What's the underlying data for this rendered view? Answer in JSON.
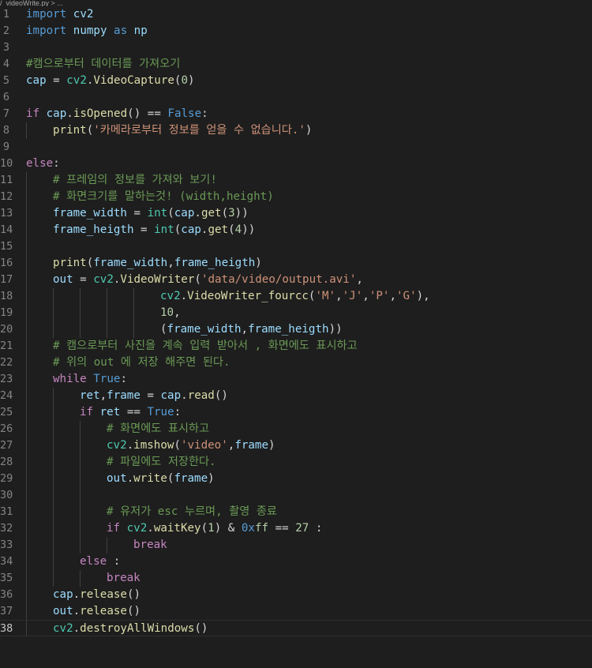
{
  "breadcrumb": "/_videoWrite.py > ...",
  "active_line": 38,
  "colors": {
    "background": "#1e1e1e",
    "keyword": "#569cd6",
    "control": "#c586c0",
    "variable": "#9cdcfe",
    "module": "#4ec9b0",
    "function": "#dcdcaa",
    "string": "#ce9178",
    "number": "#b5cea8",
    "comment": "#6a9955",
    "plain": "#d4d4d4",
    "line_number": "#858585"
  },
  "lines": [
    {
      "n": "1",
      "indent": 0,
      "tokens": [
        [
          "import",
          "kw"
        ],
        [
          " cv2",
          "var"
        ]
      ]
    },
    {
      "n": "2",
      "indent": 0,
      "tokens": [
        [
          "import",
          "kw"
        ],
        [
          " numpy ",
          "var"
        ],
        [
          "as",
          "kw"
        ],
        [
          " np",
          "var"
        ]
      ]
    },
    {
      "n": "3",
      "indent": 0,
      "tokens": []
    },
    {
      "n": "4",
      "indent": 0,
      "tokens": [
        [
          "#캠으로부터 데이터를 가져오기",
          "com"
        ]
      ]
    },
    {
      "n": "5",
      "indent": 0,
      "tokens": [
        [
          "cap",
          "var"
        ],
        [
          " = ",
          "plain"
        ],
        [
          "cv2",
          "mod"
        ],
        [
          ".",
          "plain"
        ],
        [
          "VideoCapture",
          "fn"
        ],
        [
          "(",
          "plain"
        ],
        [
          "0",
          "num"
        ],
        [
          ")",
          "plain"
        ]
      ]
    },
    {
      "n": "6",
      "indent": 0,
      "tokens": []
    },
    {
      "n": "7",
      "indent": 0,
      "tokens": [
        [
          "if",
          "ctrl"
        ],
        [
          " cap",
          "var"
        ],
        [
          ".",
          "plain"
        ],
        [
          "isOpened",
          "fn"
        ],
        [
          "() == ",
          "plain"
        ],
        [
          "False",
          "kw"
        ],
        [
          ":",
          "plain"
        ]
      ]
    },
    {
      "n": "8",
      "indent": 1,
      "tokens": [
        [
          "print",
          "fn"
        ],
        [
          "(",
          "plain"
        ],
        [
          "'카메라로부터 정보를 얻을 수 없습니다.'",
          "str"
        ],
        [
          ")",
          "plain"
        ]
      ]
    },
    {
      "n": "9",
      "indent": 0,
      "tokens": []
    },
    {
      "n": "10",
      "indent": 0,
      "tokens": [
        [
          "else",
          "ctrl"
        ],
        [
          ":",
          "plain"
        ]
      ]
    },
    {
      "n": "11",
      "indent": 1,
      "tokens": [
        [
          "# 프레임의 정보를 가져와 보기!",
          "com"
        ]
      ]
    },
    {
      "n": "12",
      "indent": 1,
      "tokens": [
        [
          "# 화면크기를 말하는것! (width,height)",
          "com"
        ]
      ]
    },
    {
      "n": "13",
      "indent": 1,
      "tokens": [
        [
          "frame_width",
          "var"
        ],
        [
          " = ",
          "plain"
        ],
        [
          "int",
          "mod"
        ],
        [
          "(",
          "plain"
        ],
        [
          "cap",
          "var"
        ],
        [
          ".",
          "plain"
        ],
        [
          "get",
          "fn"
        ],
        [
          "(",
          "plain"
        ],
        [
          "3",
          "num"
        ],
        [
          "))",
          "plain"
        ]
      ]
    },
    {
      "n": "14",
      "indent": 1,
      "tokens": [
        [
          "frame_heigth",
          "var"
        ],
        [
          " = ",
          "plain"
        ],
        [
          "int",
          "mod"
        ],
        [
          "(",
          "plain"
        ],
        [
          "cap",
          "var"
        ],
        [
          ".",
          "plain"
        ],
        [
          "get",
          "fn"
        ],
        [
          "(",
          "plain"
        ],
        [
          "4",
          "num"
        ],
        [
          "))",
          "plain"
        ]
      ]
    },
    {
      "n": "15",
      "indent": 1,
      "tokens": []
    },
    {
      "n": "16",
      "indent": 1,
      "tokens": [
        [
          "print",
          "fn"
        ],
        [
          "(",
          "plain"
        ],
        [
          "frame_width",
          "var"
        ],
        [
          ",",
          "plain"
        ],
        [
          "frame_heigth",
          "var"
        ],
        [
          ")",
          "plain"
        ]
      ]
    },
    {
      "n": "17",
      "indent": 1,
      "tokens": [
        [
          "out",
          "var"
        ],
        [
          " = ",
          "plain"
        ],
        [
          "cv2",
          "mod"
        ],
        [
          ".",
          "plain"
        ],
        [
          "VideoWriter",
          "fn"
        ],
        [
          "(",
          "plain"
        ],
        [
          "'data/video/output.avi'",
          "str"
        ],
        [
          ",",
          "plain"
        ]
      ]
    },
    {
      "n": "18",
      "indent": 5,
      "tokens": [
        [
          "cv2",
          "mod"
        ],
        [
          ".",
          "plain"
        ],
        [
          "VideoWriter_fourcc",
          "fn"
        ],
        [
          "(",
          "plain"
        ],
        [
          "'M'",
          "str"
        ],
        [
          ",",
          "plain"
        ],
        [
          "'J'",
          "str"
        ],
        [
          ",",
          "plain"
        ],
        [
          "'P'",
          "str"
        ],
        [
          ",",
          "plain"
        ],
        [
          "'G'",
          "str"
        ],
        [
          "),",
          "plain"
        ]
      ]
    },
    {
      "n": "19",
      "indent": 5,
      "tokens": [
        [
          "10",
          "num"
        ],
        [
          ",",
          "plain"
        ]
      ]
    },
    {
      "n": "20",
      "indent": 5,
      "tokens": [
        [
          "(",
          "plain"
        ],
        [
          "frame_width",
          "var"
        ],
        [
          ",",
          "plain"
        ],
        [
          "frame_heigth",
          "var"
        ],
        [
          "))",
          "plain"
        ]
      ]
    },
    {
      "n": "21",
      "indent": 1,
      "tokens": [
        [
          "# 캠으로부터 사진을 계속 입력 받아서 , 화면에도 표시하고",
          "com"
        ]
      ]
    },
    {
      "n": "22",
      "indent": 1,
      "tokens": [
        [
          "# 위의 out 에 저장 해주면 된다.",
          "com"
        ]
      ]
    },
    {
      "n": "23",
      "indent": 1,
      "tokens": [
        [
          "while",
          "ctrl"
        ],
        [
          " ",
          "plain"
        ],
        [
          "True",
          "kw"
        ],
        [
          ":",
          "plain"
        ]
      ]
    },
    {
      "n": "24",
      "indent": 2,
      "tokens": [
        [
          "ret",
          "var"
        ],
        [
          ",",
          "plain"
        ],
        [
          "frame",
          "var"
        ],
        [
          " = ",
          "plain"
        ],
        [
          "cap",
          "var"
        ],
        [
          ".",
          "plain"
        ],
        [
          "read",
          "fn"
        ],
        [
          "()",
          "plain"
        ]
      ]
    },
    {
      "n": "25",
      "indent": 2,
      "tokens": [
        [
          "if",
          "ctrl"
        ],
        [
          " ret ",
          "var"
        ],
        [
          "== ",
          "plain"
        ],
        [
          "True",
          "kw"
        ],
        [
          ":",
          "plain"
        ]
      ]
    },
    {
      "n": "26",
      "indent": 3,
      "tokens": [
        [
          "# 화면에도 표시하고",
          "com"
        ]
      ]
    },
    {
      "n": "27",
      "indent": 3,
      "tokens": [
        [
          "cv2",
          "mod"
        ],
        [
          ".",
          "plain"
        ],
        [
          "imshow",
          "fn"
        ],
        [
          "(",
          "plain"
        ],
        [
          "'video'",
          "str"
        ],
        [
          ",",
          "plain"
        ],
        [
          "frame",
          "var"
        ],
        [
          ")",
          "plain"
        ]
      ]
    },
    {
      "n": "28",
      "indent": 3,
      "tokens": [
        [
          "# 파일에도 저장한다.",
          "com"
        ]
      ]
    },
    {
      "n": "29",
      "indent": 3,
      "tokens": [
        [
          "out",
          "var"
        ],
        [
          ".",
          "plain"
        ],
        [
          "write",
          "fn"
        ],
        [
          "(",
          "plain"
        ],
        [
          "frame",
          "var"
        ],
        [
          ")",
          "plain"
        ]
      ]
    },
    {
      "n": "30",
      "indent": 3,
      "tokens": []
    },
    {
      "n": "31",
      "indent": 3,
      "tokens": [
        [
          "# 유저가 esc 누르며, 촬영 종료",
          "com"
        ]
      ]
    },
    {
      "n": "32",
      "indent": 3,
      "tokens": [
        [
          "if",
          "ctrl"
        ],
        [
          " ",
          "plain"
        ],
        [
          "cv2",
          "mod"
        ],
        [
          ".",
          "plain"
        ],
        [
          "waitKey",
          "fn"
        ],
        [
          "(",
          "plain"
        ],
        [
          "1",
          "num"
        ],
        [
          ") & ",
          "plain"
        ],
        [
          "0x",
          "kw"
        ],
        [
          "ff",
          "num"
        ],
        [
          " == ",
          "plain"
        ],
        [
          "27",
          "num"
        ],
        [
          " :",
          "plain"
        ]
      ]
    },
    {
      "n": "33",
      "indent": 4,
      "tokens": [
        [
          "break",
          "ctrl"
        ]
      ]
    },
    {
      "n": "34",
      "indent": 2,
      "tokens": [
        [
          "else",
          "ctrl"
        ],
        [
          " :",
          "plain"
        ]
      ]
    },
    {
      "n": "35",
      "indent": 3,
      "tokens": [
        [
          "break",
          "ctrl"
        ]
      ]
    },
    {
      "n": "36",
      "indent": 1,
      "tokens": [
        [
          "cap",
          "var"
        ],
        [
          ".",
          "plain"
        ],
        [
          "release",
          "fn"
        ],
        [
          "()",
          "plain"
        ]
      ]
    },
    {
      "n": "37",
      "indent": 1,
      "tokens": [
        [
          "out",
          "var"
        ],
        [
          ".",
          "plain"
        ],
        [
          "release",
          "fn"
        ],
        [
          "()",
          "plain"
        ]
      ]
    },
    {
      "n": "38",
      "indent": 1,
      "tokens": [
        [
          "cv2",
          "mod"
        ],
        [
          ".",
          "plain"
        ],
        [
          "destroyAllWindows",
          "fn"
        ],
        [
          "()",
          "plain"
        ]
      ]
    }
  ]
}
